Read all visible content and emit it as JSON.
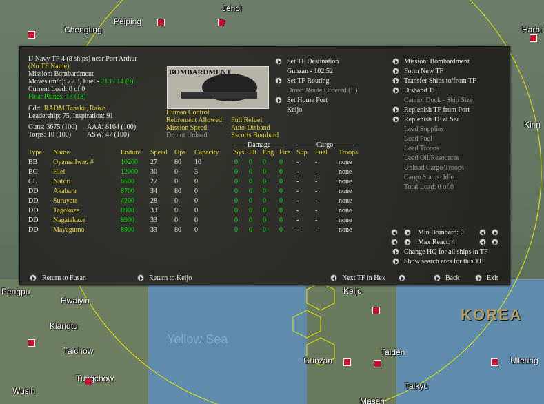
{
  "map": {
    "cities": [
      "Jehol",
      "Peiping",
      "Chengting",
      "Harbi",
      "Kirin",
      "Pengpu",
      "Hwaiyin",
      "Kiangtu",
      "Taichow",
      "Tungchow",
      "Wusih",
      "Keijo",
      "Gunzan",
      "Taiden",
      "Taikyu",
      "Ulleung",
      "Masan"
    ],
    "labels": {
      "country": "KOREA",
      "sea": "Yellow Sea"
    }
  },
  "tf": {
    "header": "IJ Navy TF 4 (8 ships) near Port Arthur",
    "name": "(No TF Name)",
    "mission": "Mission: Bombardment",
    "moves_prefix": "Moves (m/c): 7 / 3, Fuel - ",
    "moves_fuel": "213 / 14 (9)",
    "load": "Current Load: 0 of 0",
    "floatplanes": "Float Planes: 13 (13)",
    "cdr_label": "Cdr:",
    "cdr_name": "RADM Tanaka, Raizo",
    "leadership": "Leadership: 75, Inspiration: 91",
    "guns": "Guns: 3675 (100)",
    "aaa": "AAA: 8164 (100)",
    "torps": "Torps: 10 (100)",
    "asw": "ASW: 47 (100)",
    "image_title": "BOMBARDMENT"
  },
  "options_left": [
    "Human Control",
    "Retirement Allowed",
    "Mission Speed",
    "Do not Unload"
  ],
  "options_right": [
    "Full Refuel",
    "Auto-Disband",
    "Escorts Bombard"
  ],
  "destination": {
    "set_dest": "Set TF Destination",
    "dest_val": "Gunzan - 102,52",
    "set_routing": "Set TF Routing",
    "route_val": "Direct Route Ordered (!!)",
    "set_home": "Set Home Port",
    "home_val": "Keijo"
  },
  "menu": [
    {
      "label": "Mission: Bombardment",
      "enabled": true
    },
    {
      "label": "Form New TF",
      "enabled": true
    },
    {
      "label": "Transfer Ships to/from TF",
      "enabled": true
    },
    {
      "label": "Disband TF",
      "enabled": true
    },
    {
      "label": "Cannot Dock - Ship Size",
      "enabled": false
    },
    {
      "label": "Replenish TF from Port",
      "enabled": true
    },
    {
      "label": "Replenish TF at Sea",
      "enabled": true
    },
    {
      "label": "Load Supplies",
      "enabled": false
    },
    {
      "label": "Load Fuel",
      "enabled": false
    },
    {
      "label": "Load Troops",
      "enabled": false
    },
    {
      "label": "Load Oil/Resources",
      "enabled": false
    },
    {
      "label": "Unload Cargo/Troops",
      "enabled": false
    },
    {
      "label": "Cargo Status: Idle",
      "enabled": false
    },
    {
      "label": "Total Load: 0 of 0",
      "enabled": false
    }
  ],
  "controls": {
    "min_bombard": "Min Bombard: 0",
    "max_react": "Max React: 4",
    "change_hq": "Change HQ for all ships in TF",
    "show_arcs": "Show search arcs for this TF"
  },
  "table": {
    "group_damage": "Damage",
    "group_cargo": "Cargo",
    "headers": [
      "Type",
      "Name",
      "Endure",
      "Speed",
      "Ops",
      "Capacity",
      "Sys",
      "Flt",
      "Eng",
      "Fire",
      "Sup",
      "Fuel",
      "Troops"
    ],
    "rows": [
      [
        "BB",
        "Oyama Iwao #",
        "10200",
        "27",
        "80",
        "10",
        "0",
        "0",
        "0",
        "0",
        "-",
        "-",
        "none"
      ],
      [
        "BC",
        "Hiei",
        "12000",
        "30",
        "0",
        "3",
        "0",
        "0",
        "0",
        "0",
        "-",
        "-",
        "none"
      ],
      [
        "CL",
        "Natori",
        "6500",
        "27",
        "0",
        "0",
        "0",
        "0",
        "0",
        "0",
        "-",
        "-",
        "none"
      ],
      [
        "DD",
        "Akabara",
        "8700",
        "34",
        "80",
        "0",
        "0",
        "0",
        "0",
        "0",
        "-",
        "-",
        "none"
      ],
      [
        "DD",
        "Suruyate",
        "4200",
        "28",
        "0",
        "0",
        "0",
        "0",
        "0",
        "0",
        "-",
        "-",
        "none"
      ],
      [
        "DD",
        "Tagokaze",
        "8900",
        "33",
        "0",
        "0",
        "0",
        "0",
        "0",
        "0",
        "-",
        "-",
        "none"
      ],
      [
        "DD",
        "Nagatakaze",
        "8900",
        "33",
        "0",
        "0",
        "0",
        "0",
        "0",
        "0",
        "-",
        "-",
        "none"
      ],
      [
        "DD",
        "Mayagumo",
        "8900",
        "33",
        "80",
        "0",
        "0",
        "0",
        "0",
        "0",
        "-",
        "-",
        "none"
      ]
    ]
  },
  "bottom": {
    "return_fusan": "Return to Fusan",
    "return_keijo": "Return to Keijo",
    "next_tf": "Next TF in Hex",
    "back": "Back",
    "exit": "Exit"
  }
}
